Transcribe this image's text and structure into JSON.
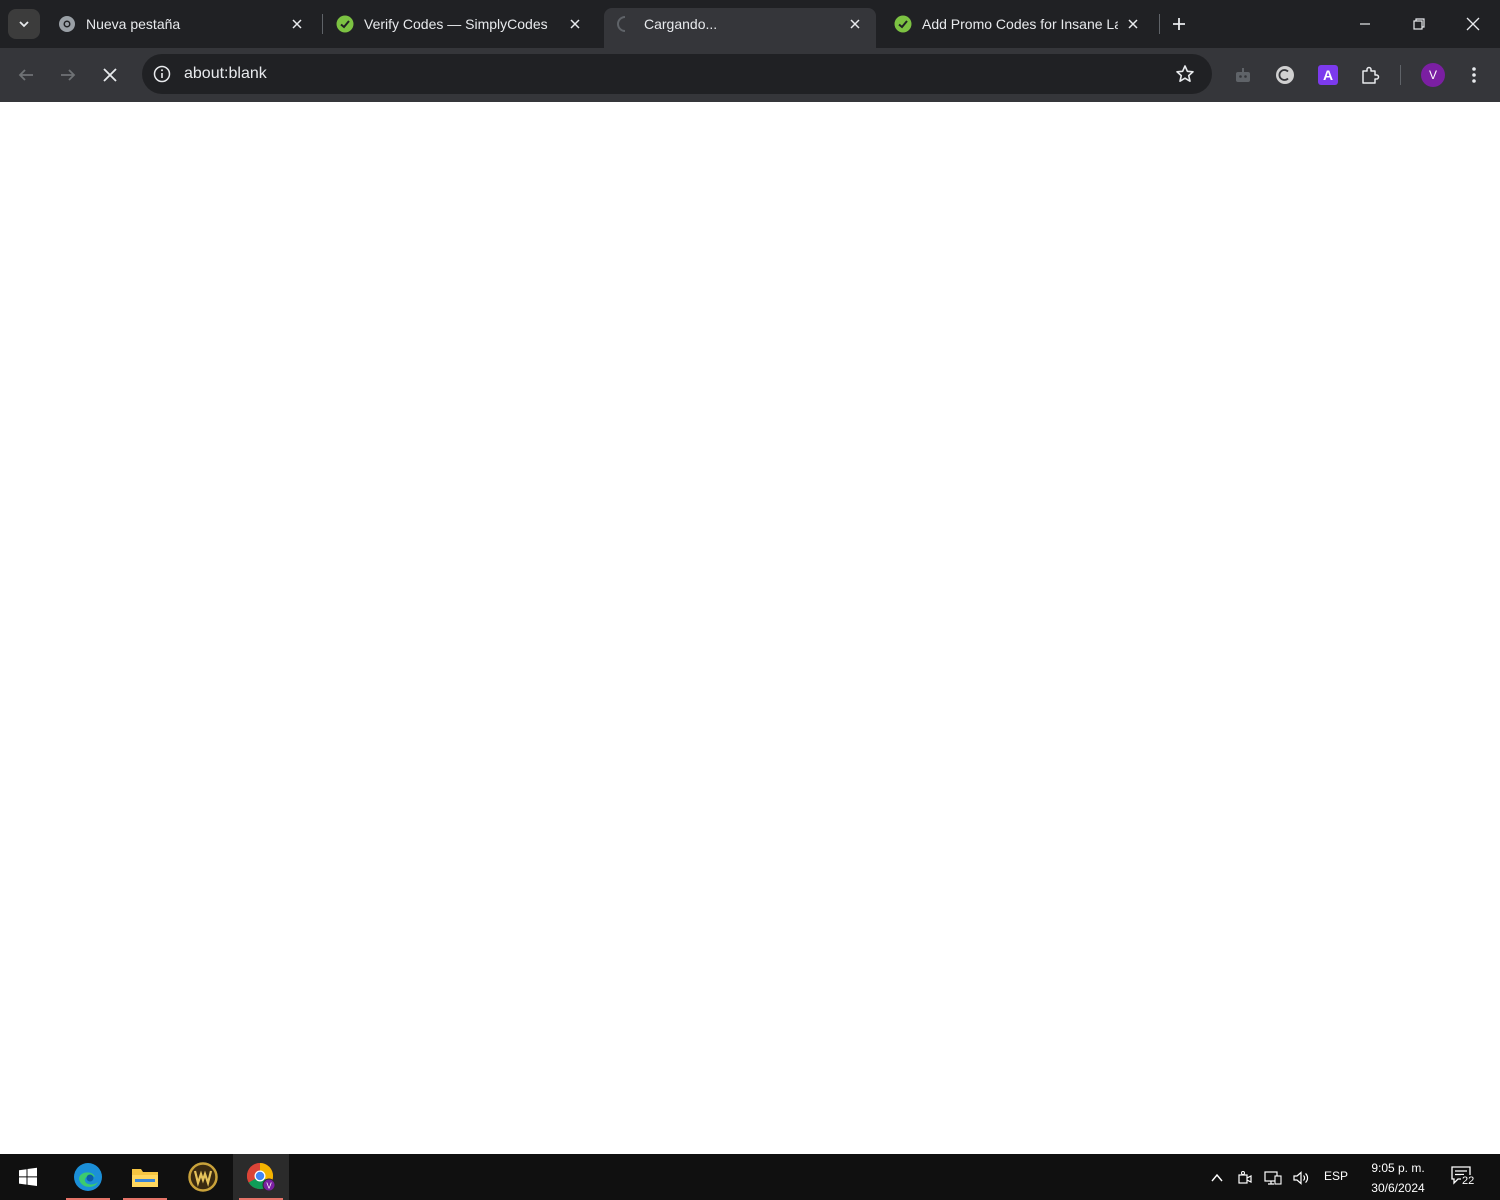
{
  "browser": {
    "tabs": [
      {
        "title": "Nueva pestaña",
        "icon": "chrome-newtab-icon",
        "active": false
      },
      {
        "title": "Verify Codes — SimplyCodes",
        "icon": "simplycodes-icon",
        "active": false
      },
      {
        "title": "Cargando...",
        "icon": "loading-spinner-icon",
        "active": true
      },
      {
        "title": "Add Promo Codes for Insane La",
        "icon": "simplycodes-icon",
        "active": false
      }
    ],
    "address": {
      "url": "about:blank"
    },
    "profile_initial": "V",
    "extension_letter": "A"
  },
  "colors": {
    "tabstrip": "#202124",
    "toolbar": "#35363a",
    "omnibox": "#202124",
    "simplycodes_green": "#7cc242",
    "extension_purple": "#7c3aed",
    "avatar_purple": "#7b1fa2",
    "taskbar": "#101010",
    "taskbar_indicator": "#e57368"
  },
  "taskbar": {
    "apps": [
      "windows-start-icon",
      "edge-icon",
      "file-explorer-icon",
      "world-of-warcraft-icon",
      "chrome-icon"
    ],
    "language": "ESP",
    "time": "9:05 p. m.",
    "date": "30/6/2024",
    "notification_count": "22"
  }
}
